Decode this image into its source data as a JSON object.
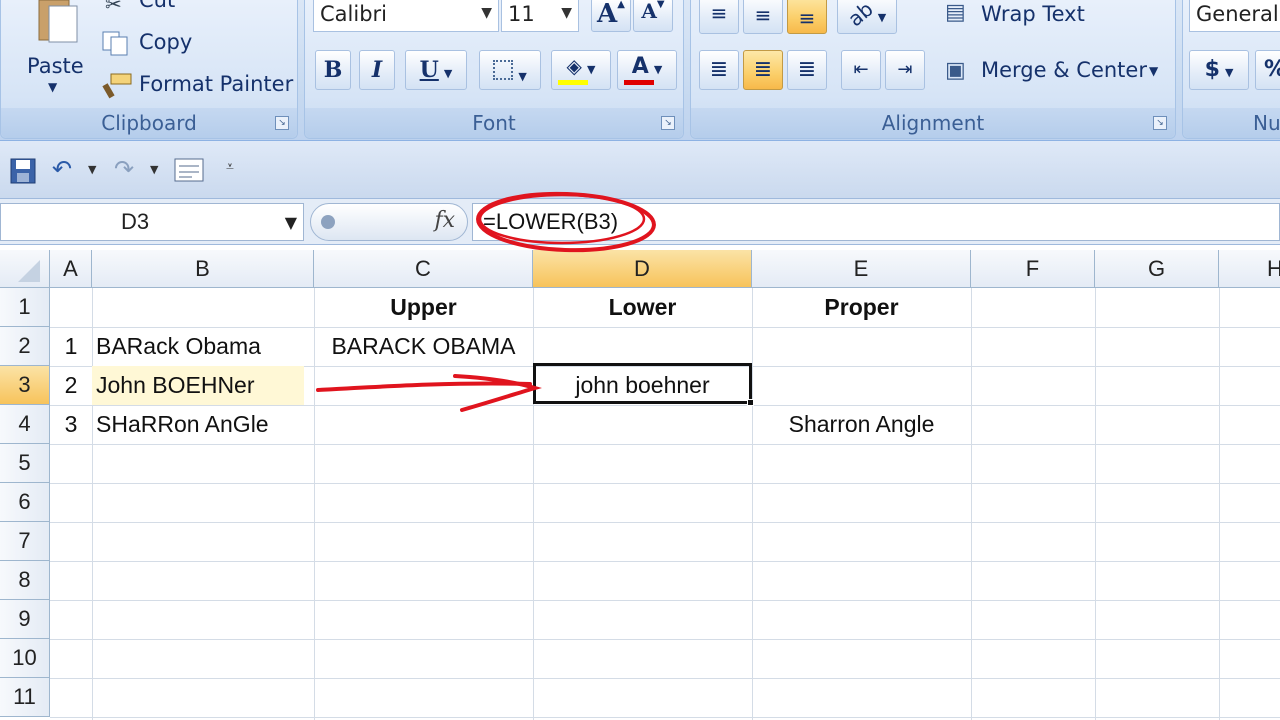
{
  "ribbon": {
    "clipboard": {
      "paste_label": "Paste",
      "cut_label": "Cut",
      "copy_label": "Copy",
      "format_painter_label": "Format Painter",
      "group_label": "Clipboard"
    },
    "font": {
      "font_name": "Calibri",
      "font_size": "11",
      "bold": "B",
      "italic": "I",
      "underline": "U",
      "grow": "A",
      "shrink": "A",
      "font_color_glyph": "A",
      "group_label": "Font",
      "fill_color": "#ffff00",
      "font_color": "#e00000"
    },
    "alignment": {
      "wrap_text_label": "Wrap Text",
      "merge_center_label": "Merge & Center",
      "group_label": "Alignment"
    },
    "number": {
      "format_value": "General",
      "currency_symbol": "$",
      "percent_symbol": "%",
      "group_label": "Nu"
    }
  },
  "formula_bar": {
    "name_box": "D3",
    "fx_label": "fx",
    "formula": "=LOWER(B3)"
  },
  "grid": {
    "columns": [
      "A",
      "B",
      "C",
      "D",
      "E",
      "F",
      "G",
      "H"
    ],
    "rows": [
      "1",
      "2",
      "3",
      "4",
      "5",
      "6",
      "7",
      "8",
      "9",
      "10",
      "11"
    ],
    "selected_column": "D",
    "selected_row": "3",
    "cells": {
      "C1": "Upper",
      "D1": "Lower",
      "E1": "Proper",
      "A2": "1",
      "B2": "BARack Obama",
      "C2": "BARACK OBAMA",
      "A3": "2",
      "B3": "John BOEHNer",
      "D3": "john boehner",
      "A4": "3",
      "B4": "SHaRRon AnGle",
      "E4": "Sharron Angle"
    }
  },
  "colors": {
    "selection_header": "#f7c35b",
    "annotation": "#e0141e",
    "highlight_b3": "#fff8d6"
  }
}
